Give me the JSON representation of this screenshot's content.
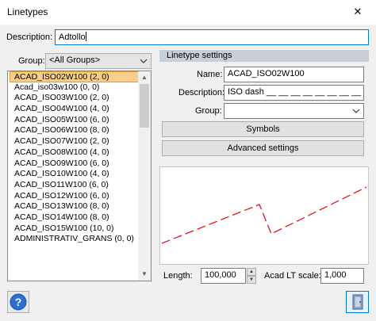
{
  "window": {
    "title": "Linetypes",
    "close_glyph": "✕"
  },
  "description": {
    "label": "Description:",
    "value": "Adtollo"
  },
  "group_filter": {
    "label": "Group:",
    "value": "<All Groups>"
  },
  "toolbar": {
    "icons": [
      "new-linetype-icon",
      "delete-icon",
      "purge-icon",
      "import-icon"
    ]
  },
  "linetype_list": {
    "items": [
      "ACAD_ISO02W100 (2, 0)",
      "Acad_iso03w100 (0, 0)",
      "ACAD_ISO03W100 (2, 0)",
      "ACAD_ISO04W100 (4, 0)",
      "ACAD_ISO05W100 (6, 0)",
      "ACAD_ISO06W100 (8, 0)",
      "ACAD_ISO07W100 (2, 0)",
      "ACAD_ISO08W100 (4, 0)",
      "ACAD_ISO09W100 (6, 0)",
      "ACAD_ISO10W100 (4, 0)",
      "ACAD_ISO11W100 (6, 0)",
      "ACAD_ISO12W100 (6, 0)",
      "ACAD_ISO13W100 (8, 0)",
      "ACAD_ISO14W100 (8, 0)",
      "ACAD_ISO15W100 (10, 0)",
      "ADMINISTRATIV_GRANS (0, 0)"
    ],
    "selected_index": 0
  },
  "settings": {
    "header": "Linetype settings",
    "name_label": "Name:",
    "name_value": "ACAD_ISO02W100",
    "description_label": "Description:",
    "description_value": "ISO dash __ __ __ __ __ __ __ __ __ __",
    "group_label": "Group:",
    "group_value": "",
    "symbols_button": "Symbols",
    "advanced_button": "Advanced settings"
  },
  "preview": {
    "line_color": "#e0141e"
  },
  "length": {
    "label": "Length:",
    "value": "100,000"
  },
  "lt_scale": {
    "label": "Acad LT scale:",
    "value": "1,000"
  }
}
